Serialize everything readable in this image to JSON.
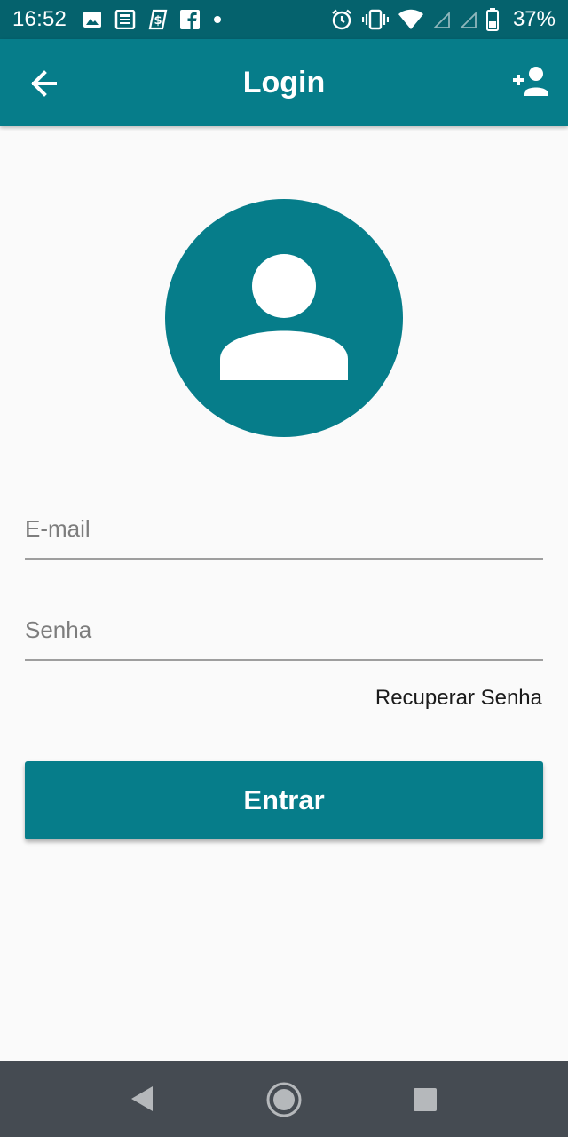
{
  "status_bar": {
    "time": "16:52",
    "battery_percent": "37%",
    "left_icons": [
      "image-icon",
      "news-icon",
      "money-icon",
      "facebook-icon",
      "dot-icon"
    ],
    "right_icons": [
      "alarm-icon",
      "vibrate-icon",
      "wifi-icon",
      "signal-icon",
      "signal-icon",
      "battery-icon"
    ]
  },
  "app_bar": {
    "title": "Login",
    "back_icon": "arrow-back-icon",
    "action_icon": "person-add-icon"
  },
  "avatar": {
    "icon": "person-icon"
  },
  "form": {
    "email_placeholder": "E-mail",
    "email_value": "",
    "password_placeholder": "Senha",
    "password_value": "",
    "recover_label": "Recuperar Senha",
    "submit_label": "Entrar"
  },
  "nav_bar": {
    "icons": [
      "nav-back-icon",
      "nav-home-icon",
      "nav-recents-icon"
    ]
  },
  "colors": {
    "primary": "#067d8a",
    "status_bar": "#05626d",
    "background": "#fafafa",
    "nav_bar": "#454b52"
  }
}
